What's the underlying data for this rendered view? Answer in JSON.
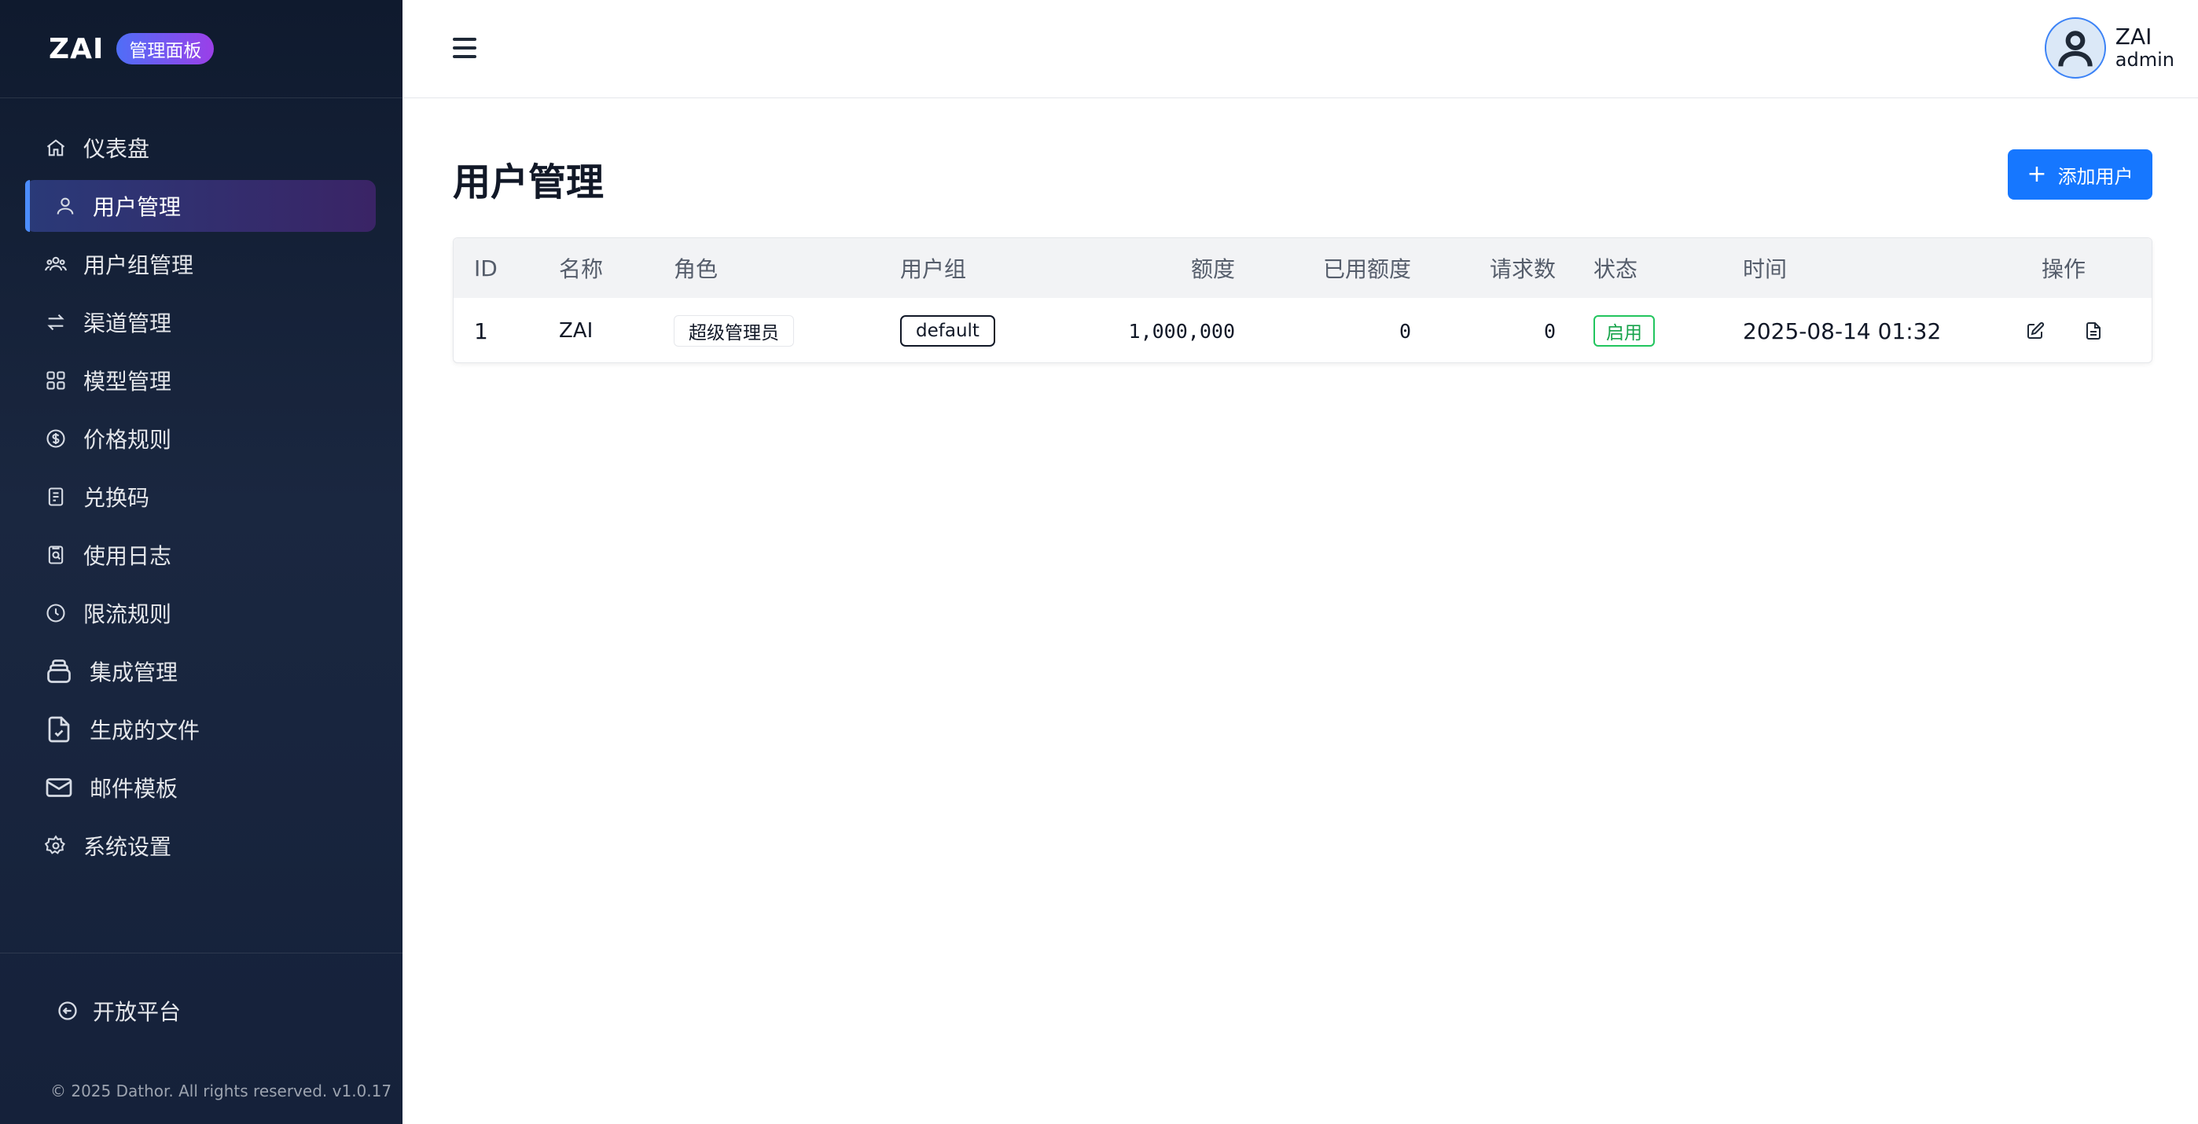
{
  "brand": {
    "logo": "ZAI",
    "badge": "管理面板"
  },
  "sidebar": {
    "items": [
      {
        "label": "仪表盘",
        "icon": "home-icon"
      },
      {
        "label": "用户管理",
        "icon": "user-icon",
        "active": true
      },
      {
        "label": "用户组管理",
        "icon": "users-icon"
      },
      {
        "label": "渠道管理",
        "icon": "swap-icon"
      },
      {
        "label": "模型管理",
        "icon": "grid-icon"
      },
      {
        "label": "价格规则",
        "icon": "dollar-circle-icon"
      },
      {
        "label": "兑换码",
        "icon": "ticket-icon"
      },
      {
        "label": "使用日志",
        "icon": "log-search-icon"
      },
      {
        "label": "限流规则",
        "icon": "clock-icon"
      },
      {
        "label": "集成管理",
        "icon": "layers-icon"
      },
      {
        "label": "生成的文件",
        "icon": "file-check-icon"
      },
      {
        "label": "邮件模板",
        "icon": "mail-icon"
      },
      {
        "label": "系统设置",
        "icon": "gear-icon"
      }
    ],
    "open_platform": "开放平台",
    "copyright": "© 2025 Dathor. All rights reserved. v1.0.17"
  },
  "header": {
    "user_name": "ZAI",
    "user_role": "admin"
  },
  "main": {
    "title": "用户管理",
    "add_button": "添加用户",
    "add_button_icon": "+",
    "table": {
      "columns": [
        "ID",
        "名称",
        "角色",
        "用户组",
        "额度",
        "已用额度",
        "请求数",
        "状态",
        "时间",
        "操作"
      ],
      "rows": [
        {
          "id": "1",
          "name": "ZAI",
          "role": "超级管理员",
          "group": "default",
          "quota": "1,000,000",
          "used_quota": "0",
          "requests": "0",
          "status": "启用",
          "time": "2025-08-14 01:32"
        }
      ]
    }
  },
  "colors": {
    "accent": "#1677ff",
    "status_enabled": "#16a34a",
    "sidebar_bg": "#15213a"
  }
}
